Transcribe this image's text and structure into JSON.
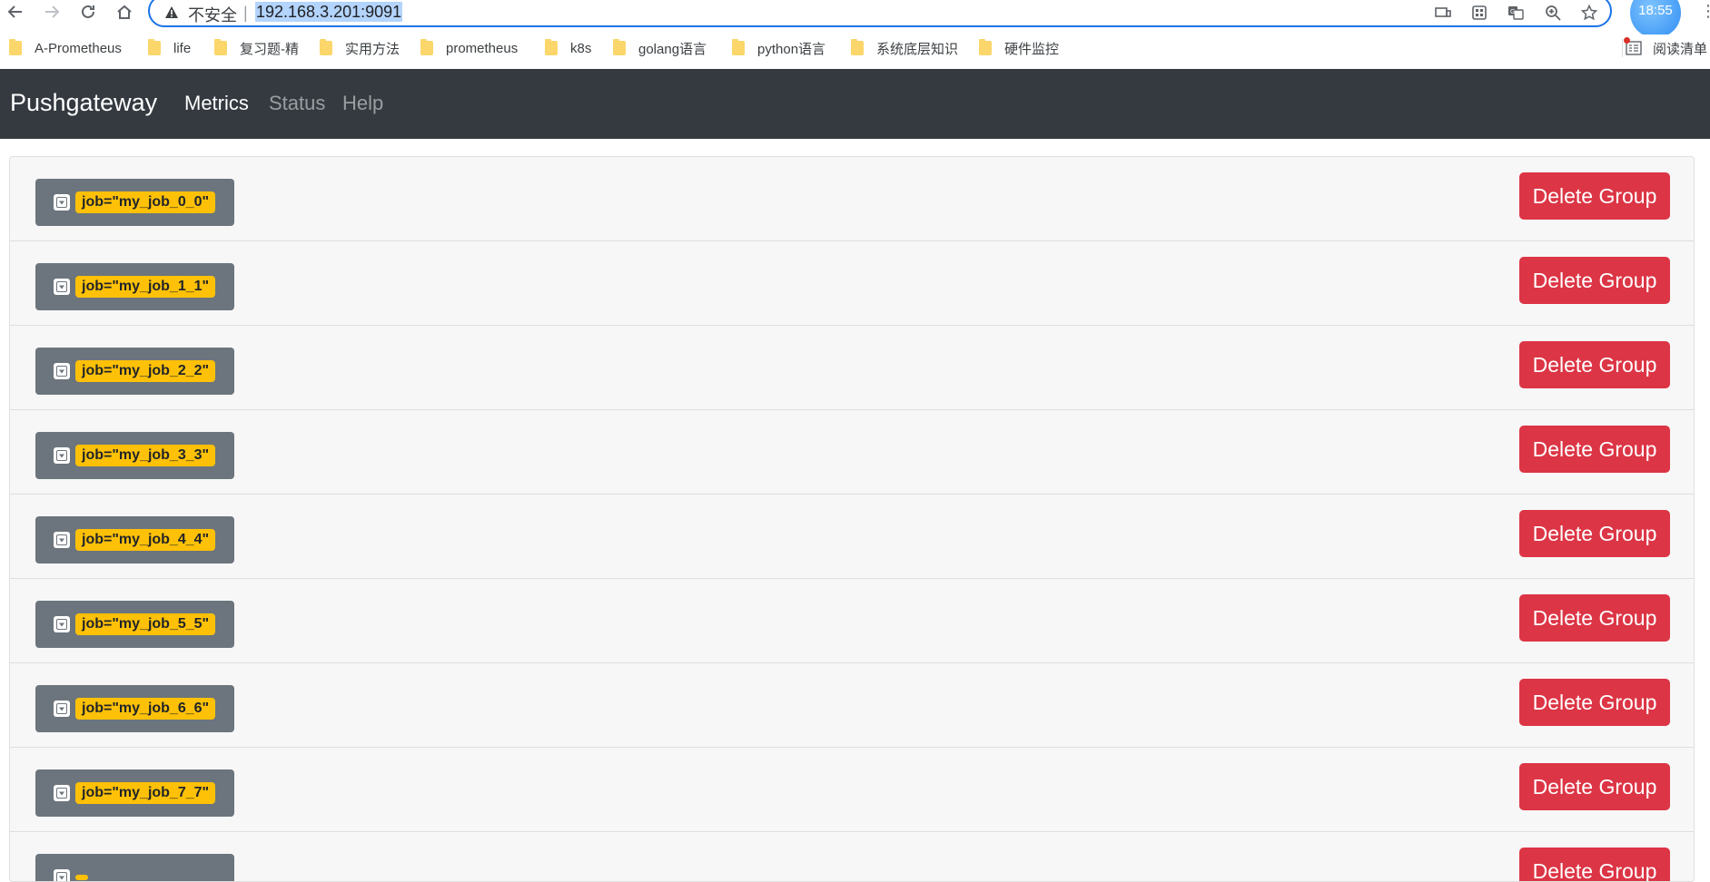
{
  "browser": {
    "insecure_label": "不安全",
    "separator": "|",
    "url": "192.168.3.201:9091",
    "clock": "18:55",
    "reading_list_label": "阅读清单"
  },
  "bookmarks": [
    {
      "label": "A-Prometheus"
    },
    {
      "label": "life"
    },
    {
      "label": "复习题-精"
    },
    {
      "label": "实用方法"
    },
    {
      "label": "prometheus"
    },
    {
      "label": "k8s"
    },
    {
      "label": "golang语言"
    },
    {
      "label": "python语言"
    },
    {
      "label": "系统底层知识"
    },
    {
      "label": "硬件监控"
    }
  ],
  "navbar": {
    "brand": "Pushgateway",
    "links": [
      {
        "label": "Metrics",
        "active": true
      },
      {
        "label": "Status",
        "active": false
      },
      {
        "label": "Help",
        "active": false
      }
    ]
  },
  "groups": [
    {
      "label": "job=\"my_job_0_0\"",
      "delete_label": "Delete Group"
    },
    {
      "label": "job=\"my_job_1_1\"",
      "delete_label": "Delete Group"
    },
    {
      "label": "job=\"my_job_2_2\"",
      "delete_label": "Delete Group"
    },
    {
      "label": "job=\"my_job_3_3\"",
      "delete_label": "Delete Group"
    },
    {
      "label": "job=\"my_job_4_4\"",
      "delete_label": "Delete Group"
    },
    {
      "label": "job=\"my_job_5_5\"",
      "delete_label": "Delete Group"
    },
    {
      "label": "job=\"my_job_6_6\"",
      "delete_label": "Delete Group"
    },
    {
      "label": "job=\"my_job_7_7\"",
      "delete_label": "Delete Group"
    },
    {
      "label": "",
      "delete_label": "Delete Group"
    }
  ],
  "colors": {
    "navbar_bg": "#343a40",
    "danger": "#dc3545",
    "warning": "#ffc107",
    "secondary": "#6c757d"
  }
}
